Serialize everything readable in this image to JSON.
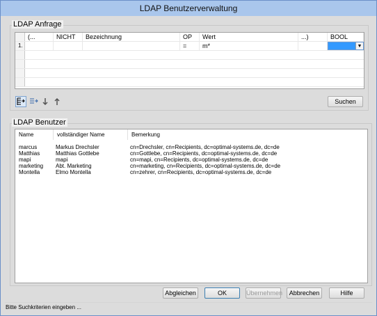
{
  "window": {
    "title": "LDAP Benutzerverwaltung"
  },
  "query_group": {
    "label": "LDAP Anfrage",
    "columns": [
      "(...",
      "NICHT",
      "Bezeichnung",
      "OP",
      "Wert",
      "...)",
      "BOOL"
    ],
    "rows": [
      {
        "num": "1.",
        "open": "",
        "not": "",
        "name": "",
        "op": "=",
        "value": "m*",
        "close": "",
        "bool": ""
      }
    ],
    "toolbar": [
      "add-row",
      "insert-row",
      "move-down",
      "move-up"
    ],
    "search_label": "Suchen"
  },
  "users_group": {
    "label": "LDAP Benutzer",
    "columns": [
      "Name",
      "vollständiger Name",
      "Bemerkung"
    ],
    "rows": [
      {
        "name": "marcus",
        "full": "Markus Drechsler",
        "note": "cn=Drechsler, cn=Recipients, dc=optimal-systems.de, dc=de"
      },
      {
        "name": "Matthias",
        "full": "Matthias Gottlebe",
        "note": "cn=Gottlebe, cn=Recipients, dc=optimal-systems.de, dc=de"
      },
      {
        "name": "mapi",
        "full": "mapi",
        "note": "cn=mapi, cn=Recipients, dc=optimal-systems.de, dc=de"
      },
      {
        "name": "marketing",
        "full": "Abt. Marketing",
        "note": "cn=marketing, cn=Recipients, dc=optimal-systems.de, dc=de"
      },
      {
        "name": "Montella",
        "full": "Elmo Montella",
        "note": "cn=zehrer, cn=Recipients, dc=optimal-systems.de, dc=de"
      }
    ]
  },
  "buttons": {
    "sync": "Abgleichen",
    "ok": "OK",
    "apply": "Übernehmen",
    "cancel": "Abbrechen",
    "help": "Hilfe"
  },
  "status": "Bitte Suchkriterien eingeben ..."
}
